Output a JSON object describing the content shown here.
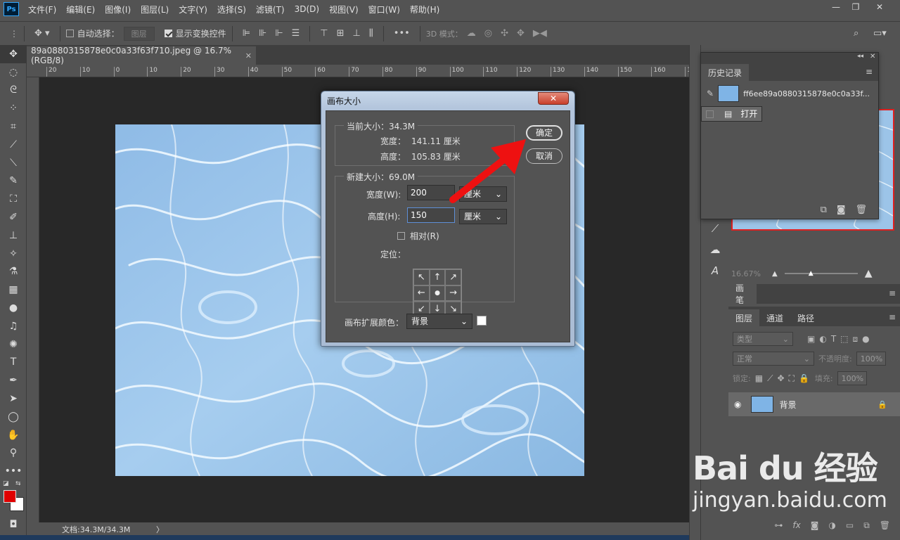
{
  "app": {
    "logo": "Ps"
  },
  "menu": [
    "文件(F)",
    "编辑(E)",
    "图像(I)",
    "图层(L)",
    "文字(Y)",
    "选择(S)",
    "滤镜(T)",
    "3D(D)",
    "视图(V)",
    "窗口(W)",
    "帮助(H)"
  ],
  "window_controls": {
    "minimize": "—",
    "restore": "❐",
    "close": "✕"
  },
  "options_bar": {
    "auto_select_label": "自动选择：",
    "auto_select_value": "图层",
    "show_transform_label": "显示变换控件",
    "three_d_mode": "3D 模式："
  },
  "document": {
    "tab_title": "89a0880315878e0c0a33f63f710.jpeg @ 16.7%(RGB/8)",
    "close_symbol": "✕",
    "ruler_labels": [
      "20",
      "10",
      "0",
      "10",
      "20",
      "30",
      "40",
      "50",
      "60",
      "70",
      "80",
      "90",
      "100",
      "110",
      "120",
      "130",
      "140",
      "150",
      "160",
      "170"
    ],
    "status": "文档:34.3M/34.3M",
    "status_arrow": "〉"
  },
  "dialog": {
    "title": "画布大小",
    "close": "✕",
    "current_size_label": "当前大小：34.3M",
    "current_width_label": "宽度：",
    "current_width_value": "141.11 厘米",
    "current_height_label": "高度：",
    "current_height_value": "105.83 厘米",
    "new_size_label": "新建大小：69.0M",
    "width_label": "宽度(W):",
    "width_value": "200",
    "width_unit": "厘米",
    "height_label": "高度(H):",
    "height_value": "150",
    "height_unit": "厘米",
    "relative_label": "相对(R)",
    "anchor_label": "定位：",
    "anchor_cells": [
      "↖",
      "↑",
      "↗",
      "←",
      "●",
      "→",
      "↙",
      "↓",
      "↘"
    ],
    "extension_color_label": "画布扩展颜色：",
    "extension_color_value": "背景",
    "ok_button": "确定",
    "cancel_button": "取消"
  },
  "history_panel": {
    "tab": "历史记录",
    "snapshot_name": "ff6ee89a0880315878e0c0a33f...",
    "step_open": "打开"
  },
  "navigator": {
    "zoom": "16.67%"
  },
  "brush_tab": "画笔",
  "layers_panel": {
    "tabs": [
      "图层",
      "通道",
      "路径"
    ],
    "filter_kind": "类型",
    "blend_mode": "正常",
    "opacity_label": "不透明度:",
    "opacity_value": "100%",
    "lock_label": "锁定:",
    "fill_label": "填充:",
    "fill_value": "100%",
    "layer_name": "背景"
  },
  "watermark": {
    "logo": "Bai du 经验",
    "url": "jingyan.baidu.com"
  },
  "colors": {
    "foreground": "#e00000",
    "background": "#ffffff",
    "accent_arrow": "#ee1111"
  }
}
